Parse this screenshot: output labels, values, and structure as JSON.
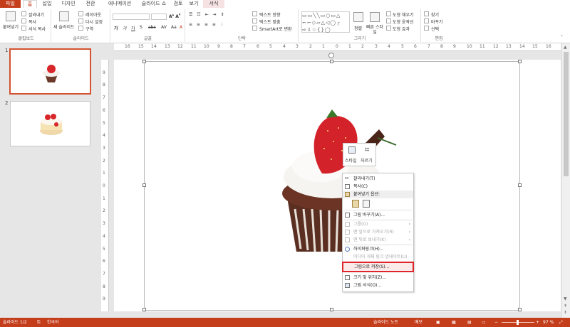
{
  "tabs": [
    "파일",
    "홈",
    "삽입",
    "디자인",
    "전환",
    "애니메이션",
    "슬라이드 쇼",
    "검토",
    "보기",
    "서식"
  ],
  "ribbon": {
    "clipboard": {
      "paste": "붙여넣기",
      "cut": "잘라내기",
      "copy": "복사",
      "format_painter": "서식 복사",
      "label": "클립보드"
    },
    "slides": {
      "new_slide": "새 슬라이드",
      "layout": "레이아웃",
      "reset": "다시 설정",
      "section": "구역",
      "label": "슬라이드"
    },
    "font": {
      "label": "글꼴"
    },
    "paragraph": {
      "text_direction": "텍스트 방향",
      "align_text": "텍스트 맞춤",
      "smartart": "SmartArt로 변환",
      "label": "단락"
    },
    "drawing": {
      "arrange": "정렬",
      "quick_styles": "빠른 스타일",
      "shape_fill": "도형 채우기",
      "shape_outline": "도형 윤곽선",
      "shape_effects": "도형 효과",
      "label": "그리기"
    },
    "editing": {
      "find": "찾기",
      "replace": "바꾸기",
      "select": "선택",
      "label": "편집"
    }
  },
  "slides_pane": {
    "slide1_num": "1",
    "slide2_num": "2"
  },
  "ruler": {
    "h_ticks": [
      "16",
      "15",
      "14",
      "13",
      "12",
      "11",
      "10",
      "9",
      "8",
      "7",
      "6",
      "5",
      "4",
      "3",
      "2",
      "1",
      "0",
      "1",
      "2",
      "3",
      "4",
      "5",
      "6",
      "7",
      "8",
      "9",
      "10",
      "11",
      "12",
      "13",
      "14",
      "15",
      "16"
    ],
    "v_ticks": [
      "9",
      "8",
      "7",
      "6",
      "5",
      "4",
      "3",
      "2",
      "1",
      "0",
      "1",
      "2",
      "3",
      "4",
      "5",
      "6",
      "7",
      "8",
      "9"
    ]
  },
  "mini_toolbar": {
    "style": "스타일",
    "crop": "자르기"
  },
  "context_menu": {
    "cut": "잘라내기(T)",
    "copy": "복사(C)",
    "paste_options": "붙여넣기 옵션:",
    "change_picture": "그림 바꾸기(A)...",
    "group": "그룹(G)",
    "bring_front": "맨 앞으로 가져오기(R)",
    "send_back": "맨 뒤로 보내기(K)",
    "hyperlink": "하이퍼링크(H)...",
    "action_settings": "미디어 개체 링크 업데이트(U)",
    "save_as_picture": "그림으로 저장(S)...",
    "size_position": "크기 및 위치(Z)...",
    "format_picture": "그림 서식(O)..."
  },
  "status": {
    "slide_info": "슬라이드 1/2",
    "language": "한국어",
    "notes": "슬라이드 노트",
    "comments": "메모",
    "zoom": "97 %"
  },
  "colors": {
    "accent": "#c43e1c",
    "menu_highlight": "#e0242b"
  },
  "icons": [
    "paste-icon",
    "scissors-icon",
    "copy-icon",
    "brush-icon",
    "layout-icon",
    "shapes-icon",
    "find-icon",
    "replace-icon"
  ]
}
